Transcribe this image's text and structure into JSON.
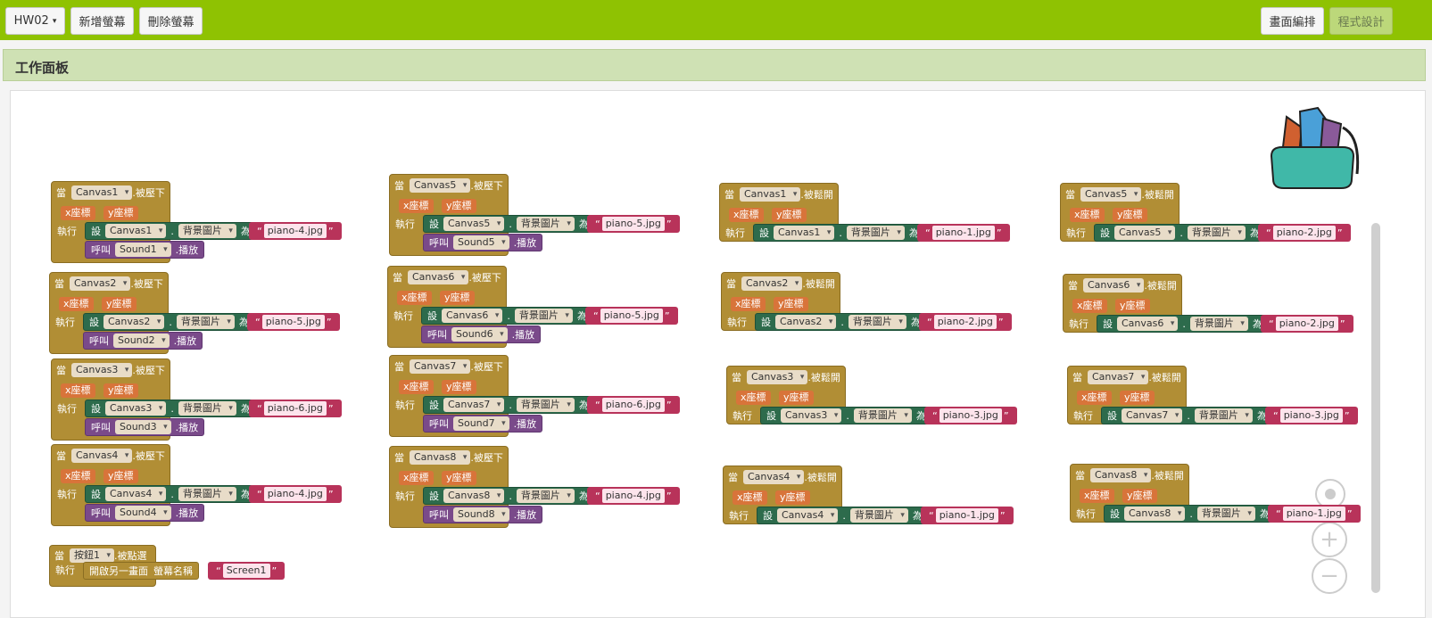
{
  "topbar": {
    "project": "HW02",
    "add_screen": "新增螢幕",
    "delete_screen": "刪除螢幕",
    "designer": "畫面編排",
    "blocks": "程式設計"
  },
  "panel": {
    "title": "工作面板"
  },
  "labels": {
    "when": "當",
    "do": "執行",
    "set": "設",
    "to": "為",
    "call": "呼叫",
    "play": ".播放",
    "bg": "背景圖片",
    "x": "x座標",
    "y": "y座標",
    "dot": "."
  },
  "press_events": [
    {
      "canvas": "Canvas1",
      "event": ".被壓下",
      "image": "piano-4.jpg",
      "sound": "Sound1"
    },
    {
      "canvas": "Canvas2",
      "event": ".被壓下",
      "image": "piano-5.jpg",
      "sound": "Sound2"
    },
    {
      "canvas": "Canvas3",
      "event": ".被壓下",
      "image": "piano-6.jpg",
      "sound": "Sound3"
    },
    {
      "canvas": "Canvas4",
      "event": ".被壓下",
      "image": "piano-4.jpg",
      "sound": "Sound4"
    },
    {
      "canvas": "Canvas5",
      "event": ".被壓下",
      "image": "piano-5.jpg",
      "sound": "Sound5"
    },
    {
      "canvas": "Canvas6",
      "event": ".被壓下",
      "image": "piano-5.jpg",
      "sound": "Sound6"
    },
    {
      "canvas": "Canvas7",
      "event": ".被壓下",
      "image": "piano-6.jpg",
      "sound": "Sound7"
    },
    {
      "canvas": "Canvas8",
      "event": ".被壓下",
      "image": "piano-4.jpg",
      "sound": "Sound8"
    }
  ],
  "release_events": [
    {
      "canvas": "Canvas1",
      "event": ".被鬆開",
      "image": "piano-1.jpg"
    },
    {
      "canvas": "Canvas2",
      "event": ".被鬆開",
      "image": "piano-2.jpg"
    },
    {
      "canvas": "Canvas3",
      "event": ".被鬆開",
      "image": "piano-3.jpg"
    },
    {
      "canvas": "Canvas4",
      "event": ".被鬆開",
      "image": "piano-1.jpg"
    },
    {
      "canvas": "Canvas5",
      "event": ".被鬆開",
      "image": "piano-2.jpg"
    },
    {
      "canvas": "Canvas6",
      "event": ".被鬆開",
      "image": "piano-2.jpg"
    },
    {
      "canvas": "Canvas7",
      "event": ".被鬆開",
      "image": "piano-3.jpg"
    },
    {
      "canvas": "Canvas8",
      "event": ".被鬆開",
      "image": "piano-1.jpg"
    }
  ],
  "button_event": {
    "component": "按鈕1",
    "event": ".被點選",
    "action": "開啟另一畫面",
    "param": "螢幕名稱",
    "value": "Screen1"
  },
  "colors": {
    "topbar": "#8fc202",
    "event_block": "#b18e35",
    "set_block": "#2d6b4c",
    "call_block": "#7a4a8a",
    "text_block": "#b8335a",
    "param": "#d8743a"
  },
  "icons": {
    "backpack": "backpack-icon",
    "center": "crosshair-icon",
    "zoom_in": "plus-icon",
    "zoom_out": "minus-icon"
  }
}
